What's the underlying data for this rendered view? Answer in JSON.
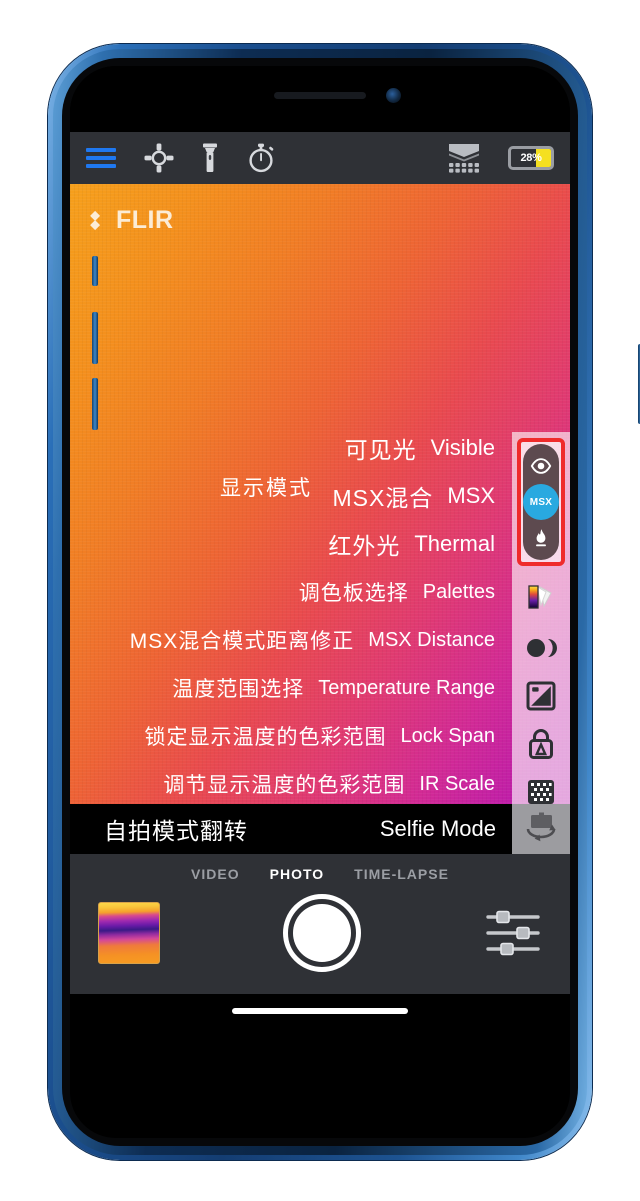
{
  "device": {
    "frame_color": "#1b4f8f",
    "name": "iphone-blue"
  },
  "status_bar": {
    "battery_percent": "28%",
    "battery_level": 28,
    "battery_fill_color": "#f5e020"
  },
  "toolbar": {
    "menu_icon": "hamburger-menu-icon",
    "menu_color": "#1f78f0",
    "spotmeter_icon": "spot-meter-crosshair-icon",
    "flashlight_icon": "flashlight-icon",
    "timer_icon": "stopwatch-timer-icon",
    "gallery_icon": "layers-stack-icon",
    "battery_icon": "battery-icon"
  },
  "viewfinder": {
    "brand": "FLIR",
    "brand_mark": "flir-diamond-icon",
    "palette_start": "#f6a01c",
    "palette_end": "#b71bb0"
  },
  "menu": {
    "group_label_cn": "显示模式",
    "display_modes": [
      {
        "cn": "可见光",
        "en": "Visible",
        "icon": "eye-icon",
        "active": false
      },
      {
        "cn": "MSX混合",
        "en": "MSX",
        "icon": "msx-icon",
        "active": true
      },
      {
        "cn": "红外光",
        "en": "Thermal",
        "icon": "flame-icon",
        "active": false
      }
    ],
    "highlight_color": "#ef2b2b",
    "active_color": "#29a9e0",
    "options": [
      {
        "cn": "调色板选择",
        "en": "Palettes",
        "icon": "palette-swatch-icon"
      },
      {
        "cn": "MSX混合模式距离修正",
        "en": "MSX Distance",
        "icon": "two-circles-overlap-icon"
      },
      {
        "cn": "温度范围选择",
        "en": "Temperature Range",
        "icon": "contrast-square-icon"
      },
      {
        "cn": "锁定显示温度的色彩范围",
        "en": "Lock Span",
        "icon": "lock-icon"
      },
      {
        "cn": "调节显示温度的色彩范围",
        "en": "IR Scale",
        "icon": "ir-scale-grid-icon"
      }
    ],
    "selfie": {
      "cn": "自拍模式翻转",
      "en": "Selfie Mode",
      "icon": "flip-camera-icon"
    }
  },
  "camera_controls": {
    "tabs": [
      {
        "label": "VIDEO",
        "selected": false
      },
      {
        "label": "PHOTO",
        "selected": true
      },
      {
        "label": "TIME-LAPSE",
        "selected": false
      }
    ],
    "thumbnail": "last-photo-thumbnail",
    "shutter": "shutter-button",
    "settings_icon": "sliders-settings-icon"
  }
}
